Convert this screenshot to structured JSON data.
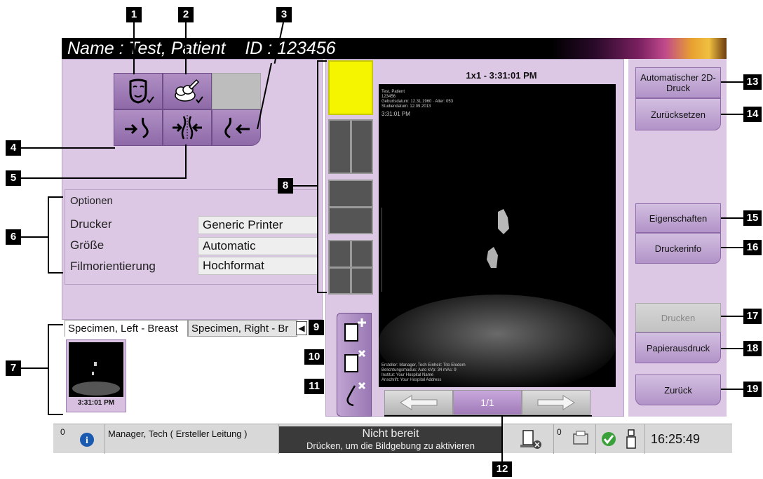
{
  "header": {
    "patient_line": "Name : Test, Patient    ID : 123456"
  },
  "options": {
    "title": "Optionen",
    "printer_label": "Drucker",
    "printer_value": "Generic Printer",
    "size_label": "Größe",
    "size_value": "Automatic",
    "orientation_label": "Filmorientierung",
    "orientation_value": "Hochformat"
  },
  "tabs": {
    "left": "Specimen, Left - Breast",
    "right": "Specimen, Right - Br",
    "prev_icon": "chevron-left-icon",
    "next_icon": "chevron-right-icon"
  },
  "thumbnail": {
    "time": "3:31:01 PM"
  },
  "preview": {
    "title": "1x1 - 3:31:01 PM",
    "overlay_name": "Test, Patient",
    "overlay_id": "123456",
    "overlay_birth": "Geburtsdatum: 12.31.1960 · Alter: 053",
    "overlay_date": "Studiendatum: 12.09.2013",
    "overlay_time": "3:31:01 PM",
    "overlay_bottom1": "Ersteller: Manager, Tech   Einheit: Tito Elodem",
    "overlay_bottom2": "Belichtungsmodus: Auto   kVp: 34   mAs: 9",
    "overlay_bottom3": "Institut: Your Hospital Name",
    "overlay_bottom4": "Anschrift: Your Hospital Address"
  },
  "navigation": {
    "page": "1/1",
    "prev_icon": "arrow-left-icon",
    "next_icon": "arrow-right-icon"
  },
  "right_buttons": {
    "auto_print": "Automatischer 2D-Druck",
    "reset": "Zurücksetzen",
    "properties": "Eigenschaften",
    "printer_info": "Druckerinfo",
    "print": "Drucken",
    "paper_print": "Papierausdruck",
    "back": "Zurück"
  },
  "status_bar": {
    "alert_count": "0",
    "user": "Manager, Tech ( Ersteller Leitung )",
    "state_title": "Nicht bereit",
    "state_sub": "Drücken, um die Bildgebung zu aktivieren",
    "queue_count": "0",
    "clock": "16:25:49"
  },
  "callouts": [
    "1",
    "2",
    "3",
    "4",
    "5",
    "6",
    "7",
    "8",
    "9",
    "10",
    "11",
    "12",
    "13",
    "14",
    "15",
    "16",
    "17",
    "18",
    "19"
  ]
}
